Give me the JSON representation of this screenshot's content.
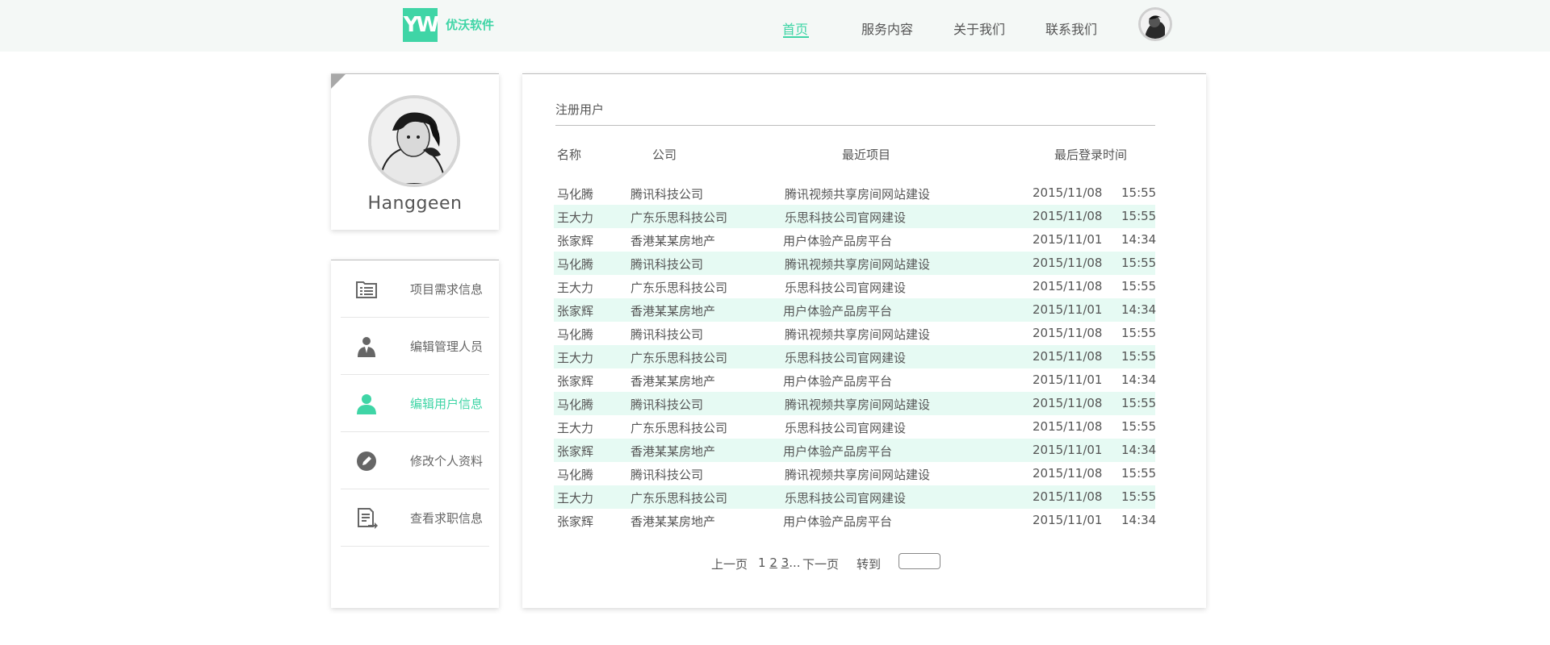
{
  "header": {
    "logo_mark": "YW",
    "logo_text": "优沃软件",
    "nav": [
      "首页",
      "服务内容",
      "关于我们",
      "联系我们"
    ],
    "active_nav": "首页"
  },
  "profile": {
    "name": "Hanggeen"
  },
  "sidebar": {
    "items": [
      {
        "label": "项目需求信息",
        "icon": "list-icon"
      },
      {
        "label": "编辑管理人员",
        "icon": "admin-user-icon"
      },
      {
        "label": "编辑用户信息",
        "icon": "user-icon"
      },
      {
        "label": "修改个人资料",
        "icon": "edit-icon"
      },
      {
        "label": "查看求职信息",
        "icon": "document-icon"
      }
    ],
    "active_index": 2
  },
  "table": {
    "title": "注册用户",
    "headers": [
      "名称",
      "公司",
      "最近项目",
      "最后登录时间"
    ],
    "rows": [
      {
        "name": "马化腾",
        "company": "腾讯科技公司",
        "project": "腾讯视频共享房间网站建设",
        "date": "2015/11/08",
        "time": "15:55"
      },
      {
        "name": "王大力",
        "company": "广东乐思科技公司",
        "project": "乐思科技公司官网建设",
        "date": "2015/11/08",
        "time": "15:55"
      },
      {
        "name": "张家辉",
        "company": "香港某某房地产",
        "project": "用户体验产品房平台",
        "date": "2015/11/01",
        "time": "14:34"
      },
      {
        "name": "马化腾",
        "company": "腾讯科技公司",
        "project": "腾讯视频共享房间网站建设",
        "date": "2015/11/08",
        "time": "15:55"
      },
      {
        "name": "王大力",
        "company": "广东乐思科技公司",
        "project": "乐思科技公司官网建设",
        "date": "2015/11/08",
        "time": "15:55"
      },
      {
        "name": "张家辉",
        "company": "香港某某房地产",
        "project": "用户体验产品房平台",
        "date": "2015/11/01",
        "time": "14:34"
      },
      {
        "name": "马化腾",
        "company": "腾讯科技公司",
        "project": "腾讯视频共享房间网站建设",
        "date": "2015/11/08",
        "time": "15:55"
      },
      {
        "name": "王大力",
        "company": "广东乐思科技公司",
        "project": "乐思科技公司官网建设",
        "date": "2015/11/08",
        "time": "15:55"
      },
      {
        "name": "张家辉",
        "company": "香港某某房地产",
        "project": "用户体验产品房平台",
        "date": "2015/11/01",
        "time": "14:34"
      },
      {
        "name": "马化腾",
        "company": "腾讯科技公司",
        "project": "腾讯视频共享房间网站建设",
        "date": "2015/11/08",
        "time": "15:55"
      },
      {
        "name": "王大力",
        "company": "广东乐思科技公司",
        "project": "乐思科技公司官网建设",
        "date": "2015/11/08",
        "time": "15:55"
      },
      {
        "name": "张家辉",
        "company": "香港某某房地产",
        "project": "用户体验产品房平台",
        "date": "2015/11/01",
        "time": "14:34"
      },
      {
        "name": "马化腾",
        "company": "腾讯科技公司",
        "project": "腾讯视频共享房间网站建设",
        "date": "2015/11/08",
        "time": "15:55"
      },
      {
        "name": "王大力",
        "company": "广东乐思科技公司",
        "project": "乐思科技公司官网建设",
        "date": "2015/11/08",
        "time": "15:55"
      },
      {
        "name": "张家辉",
        "company": "香港某某房地产",
        "project": "用户体验产品房平台",
        "date": "2015/11/01",
        "time": "14:34"
      }
    ]
  },
  "pagination": {
    "prev": "上一页",
    "pages": [
      "1",
      "2",
      "3"
    ],
    "ellipsis": "...",
    "next": "下一页",
    "goto": "转到"
  },
  "colors": {
    "accent": "#3fd5a6",
    "row_highlight": "#e6faf3",
    "header_bg": "#f4f8f6"
  }
}
